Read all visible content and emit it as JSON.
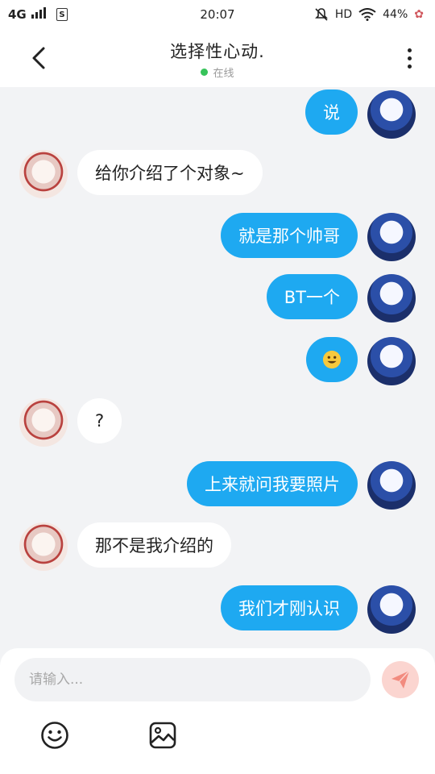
{
  "status_bar": {
    "network": "4G",
    "time": "20:07",
    "hd": "HD",
    "battery": "44%"
  },
  "header": {
    "title": "选择性心动.",
    "status": "在线"
  },
  "messages": [
    {
      "from": "self",
      "text": "说"
    },
    {
      "from": "other",
      "text": "给你介绍了个对象~"
    },
    {
      "from": "self",
      "text": "就是那个帅哥"
    },
    {
      "from": "self",
      "text": "BT一个"
    },
    {
      "from": "self",
      "text": "",
      "emoji": "smile-emoji"
    },
    {
      "from": "other",
      "text": "?"
    },
    {
      "from": "self",
      "text": "上来就问我要照片"
    },
    {
      "from": "other",
      "text": "那不是我介绍的"
    },
    {
      "from": "self",
      "text": "我们才刚认识"
    }
  ],
  "composer": {
    "placeholder": "请输入..."
  },
  "colors": {
    "self_bubble": "#1ea9f1",
    "other_bubble": "#ffffff",
    "online_dot": "#37c35a",
    "send_button": "#fbd5d0",
    "send_icon": "#f28b7f"
  },
  "icons": [
    "back-icon",
    "more-icon",
    "emoji-icon",
    "image-icon",
    "send-icon"
  ]
}
